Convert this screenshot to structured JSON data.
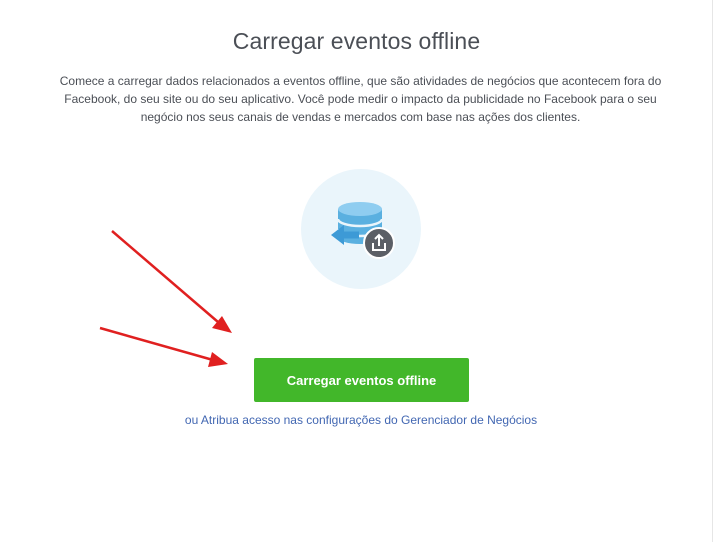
{
  "page": {
    "title": "Carregar eventos offline",
    "description": "Comece a carregar dados relacionados a eventos offline, que são atividades de negócios que acontecem fora do Facebook, do seu site ou do seu aplicativo. Você pode medir o impacto da publicidade no Facebook para o seu negócio nos seus canais de vendas e mercados com base nas ações dos clientes."
  },
  "illustration": {
    "icon": "database-upload-icon",
    "colors": {
      "circle": "#eaf5fb",
      "database": "#5ab0e0",
      "arrow": "#3d9ad6",
      "badge": "#5b5f66"
    }
  },
  "actions": {
    "upload_label": "Carregar eventos offline",
    "settings_link": "ou Atribua acesso nas configurações do Gerenciador de Negócios"
  },
  "annotations": {
    "arrow_color": "#e02020"
  },
  "colors": {
    "button": "#42b72a",
    "link": "#4267b2",
    "text": "#4b4f56"
  }
}
